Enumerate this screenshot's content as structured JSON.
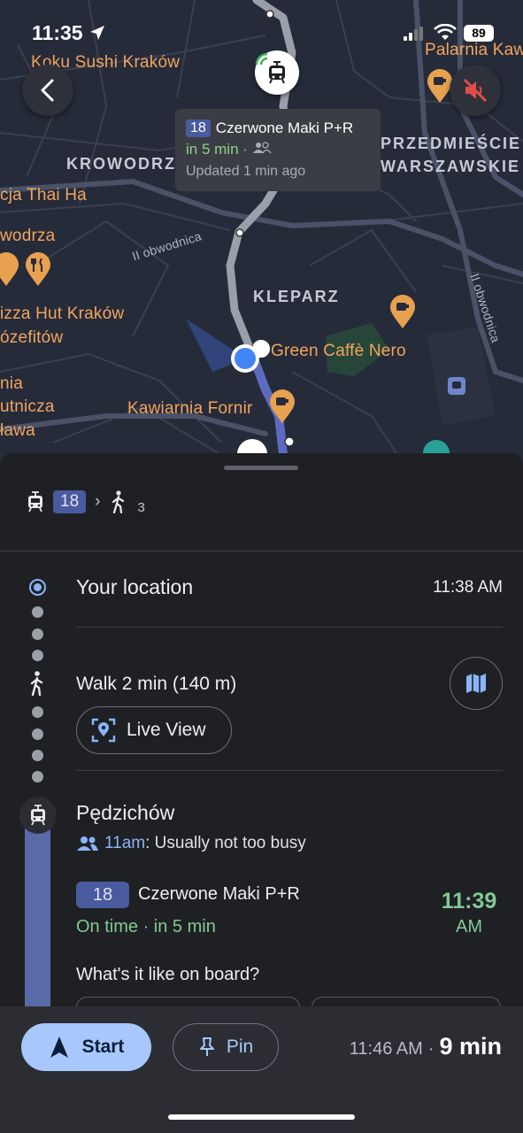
{
  "status_bar": {
    "time": "11:35",
    "battery": "89"
  },
  "map": {
    "labels": {
      "koku_sushi": "Koku Sushi Kraków",
      "palarnia": "Palarnia Kaw",
      "krowodrza": "KROWODRZ",
      "przedmiescie_1": "PRZEDMIEŚCIE",
      "przedmiescie_2": "WARSZAWSKIE",
      "thai": "cja Thai Ha",
      "wodrza": "wodrza",
      "obwodnica_1": "II obwodnica",
      "obwodnica_2": "II obwodnica",
      "kleparz": "KLEPARZ",
      "pizza_hut": "izza Hut Kraków",
      "jozefitow": "ózefitów",
      "green_caffe": "Green Caffè Nero",
      "nia": "nia",
      "utnicza": "utnicza",
      "lawa": "ława",
      "kawiarnia": "Kawiarnia Fornir"
    },
    "popup": {
      "line": "18",
      "destination": "Czerwone Maki P+R",
      "eta": "in 5 min",
      "eta_sep": "·",
      "updated": "Updated 1 min ago"
    }
  },
  "sheet": {
    "summary": {
      "line": "18",
      "arrow": "›",
      "walk_count": "3"
    },
    "steps": {
      "origin": {
        "title": "Your location",
        "time": "11:38 AM"
      },
      "walk": {
        "title": "Walk 2 min (140 m)",
        "live_view": "Live View"
      },
      "stop": {
        "title": "Pędzichów",
        "busy_time": "11am",
        "busy_text": ": Usually not too busy",
        "line": "18",
        "destination": "Czerwone Maki P+R",
        "status": "On time · in 5 min",
        "departure_time": "11:39",
        "departure_ampm": "AM",
        "onboard_question": "What's it like on board?"
      }
    }
  },
  "bottom_bar": {
    "start_label": "Start",
    "pin_label": "Pin",
    "arrival_time": "11:46 AM",
    "separator": "·",
    "duration": "9 min"
  },
  "colors": {
    "accent_blue": "#a8c7fa",
    "on_time_green": "#81c995",
    "route_badge": "#4a5a9e",
    "poi_orange": "#f2a45c"
  }
}
